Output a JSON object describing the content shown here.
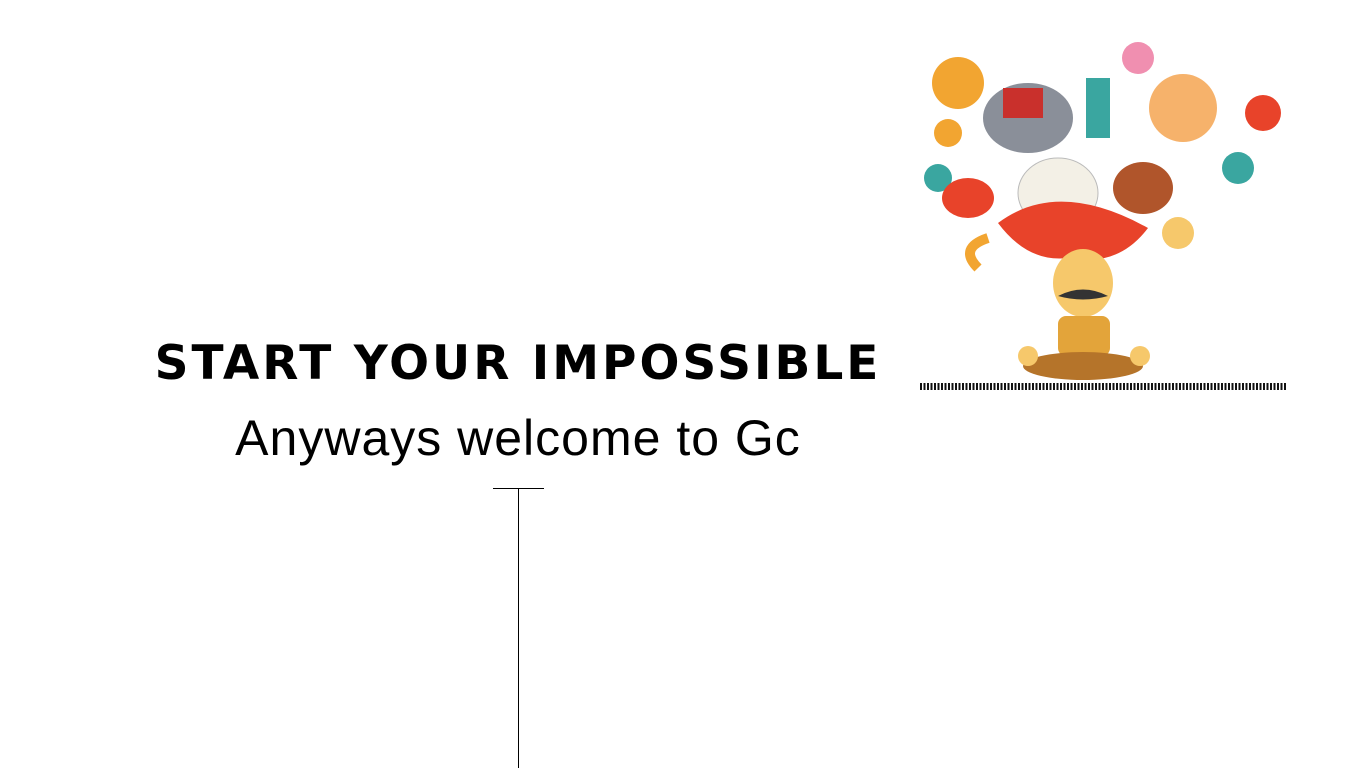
{
  "hero": {
    "headline": "START YOUR IMPOSSIBLE",
    "subtitle": "Anyways welcome to Gc"
  },
  "illustration": {
    "icon": "indian-culture-meditating-man-illustration",
    "colors": [
      "#e8432a",
      "#f2a531",
      "#3aa6a0",
      "#8a8f99",
      "#f6c86b"
    ]
  }
}
